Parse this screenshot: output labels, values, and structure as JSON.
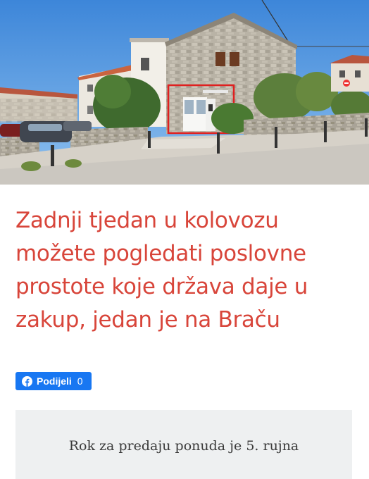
{
  "article": {
    "headline": "Zadnji tjedan u kolovozu možete pogledati poslovne prostote koje država daje u zakup, jedan je na Braču",
    "lead": "Rok za predaju ponuda je 5. rujna"
  },
  "share": {
    "label": "Podijeli",
    "count": "0",
    "icon": "facebook-icon",
    "color": "#1877f2"
  },
  "colors": {
    "headline": "#d8453a",
    "lead_box": "#eef0f1",
    "highlight": "#e02020"
  }
}
